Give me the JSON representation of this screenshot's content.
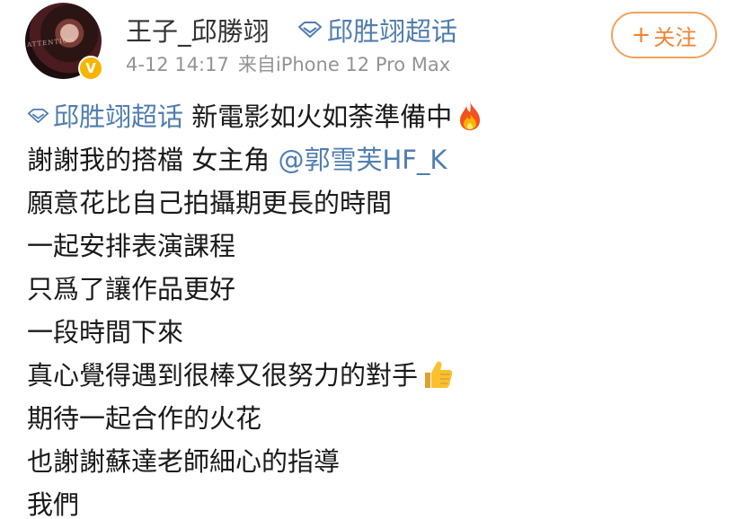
{
  "post": {
    "username": "王子_邱勝翊",
    "super_topic_label": "邱胜翊超话",
    "timestamp": "4-12 14:17",
    "source": "来自iPhone 12 Pro Max",
    "follow_label": "关注",
    "follow_icon": "plus-icon",
    "avatar_caption": "ATTENTION",
    "verified_badge": "V",
    "colors": {
      "link": "#507daf",
      "follow": "#f08330",
      "verified": "#f7b500",
      "meta": "#939393"
    }
  },
  "content": {
    "topic_link": "邱胜翊超话",
    "line1_text": " 新電影如火如荼準備中",
    "line2_text": "謝謝我的搭檔 女主角 ",
    "mention": "@郭雪芙HF_K",
    "line3": "願意花比自己拍攝期更長的時間",
    "line4": "一起安排表演課程",
    "line5": "只爲了讓作品更好",
    "line6": "一段時間下來",
    "line7_text": "真心覺得遇到很棒又很努力的對手",
    "line8": "期待一起合作的火花",
    "line9": "也謝謝蘇達老師細心的指導",
    "line10": "我們",
    "emojis": [
      "fire-emoji",
      "thumbs-up-emoji"
    ]
  }
}
